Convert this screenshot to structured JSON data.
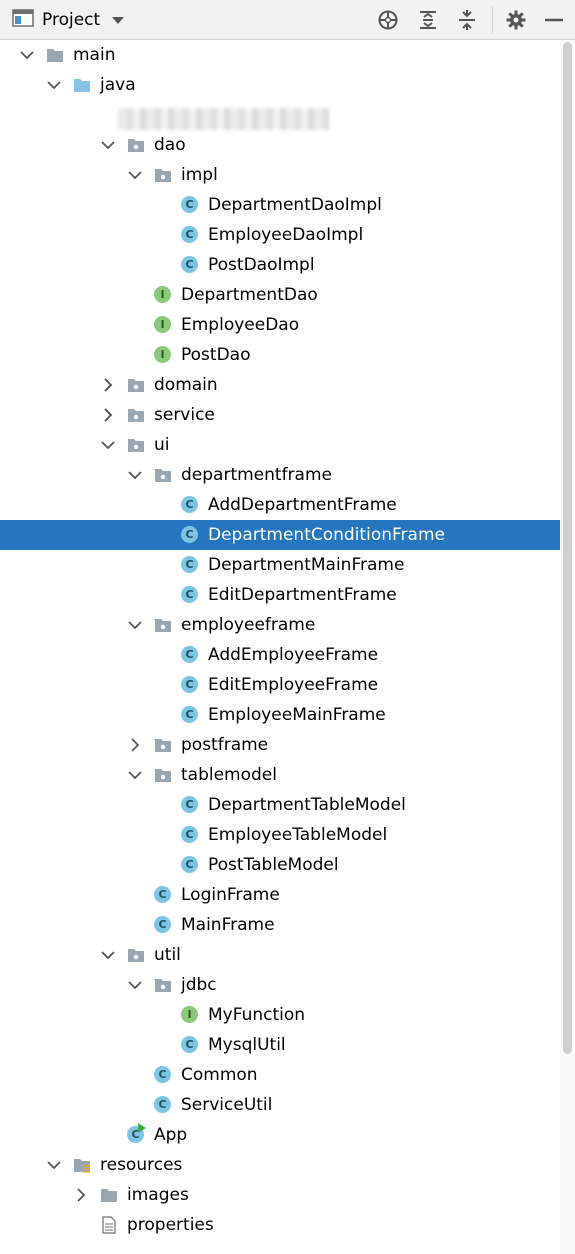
{
  "toolbar": {
    "title": "Project",
    "icons": [
      "project-window-icon",
      "dropdown-caret-icon",
      "locate-icon",
      "expand-all-icon",
      "collapse-all-icon",
      "settings-gear-icon",
      "hide-panel-icon"
    ]
  },
  "tree": {
    "rows": [
      {
        "label": "main",
        "kind": "folder",
        "expanded": true
      },
      {
        "label": "java",
        "kind": "source-folder",
        "expanded": true
      },
      {
        "label": "",
        "kind": "blurred-package"
      },
      {
        "label": "dao",
        "kind": "package",
        "expanded": true
      },
      {
        "label": "impl",
        "kind": "package",
        "expanded": true
      },
      {
        "label": "DepartmentDaoImpl",
        "kind": "class"
      },
      {
        "label": "EmployeeDaoImpl",
        "kind": "class"
      },
      {
        "label": "PostDaoImpl",
        "kind": "class"
      },
      {
        "label": "DepartmentDao",
        "kind": "interface"
      },
      {
        "label": "EmployeeDao",
        "kind": "interface"
      },
      {
        "label": "PostDao",
        "kind": "interface"
      },
      {
        "label": "domain",
        "kind": "package",
        "expanded": false
      },
      {
        "label": "service",
        "kind": "package",
        "expanded": false
      },
      {
        "label": "ui",
        "kind": "package",
        "expanded": true
      },
      {
        "label": "departmentframe",
        "kind": "package",
        "expanded": true
      },
      {
        "label": "AddDepartmentFrame",
        "kind": "class"
      },
      {
        "label": "DepartmentConditionFrame",
        "kind": "class",
        "selected": true
      },
      {
        "label": "DepartmentMainFrame",
        "kind": "class"
      },
      {
        "label": "EditDepartmentFrame",
        "kind": "class"
      },
      {
        "label": "employeeframe",
        "kind": "package",
        "expanded": true
      },
      {
        "label": "AddEmployeeFrame",
        "kind": "class"
      },
      {
        "label": "EditEmployeeFrame",
        "kind": "class"
      },
      {
        "label": "EmployeeMainFrame",
        "kind": "class"
      },
      {
        "label": "postframe",
        "kind": "package",
        "expanded": false
      },
      {
        "label": "tablemodel",
        "kind": "package",
        "expanded": true
      },
      {
        "label": "DepartmentTableModel",
        "kind": "class"
      },
      {
        "label": "EmployeeTableModel",
        "kind": "class"
      },
      {
        "label": "PostTableModel",
        "kind": "class"
      },
      {
        "label": "LoginFrame",
        "kind": "class"
      },
      {
        "label": "MainFrame",
        "kind": "class"
      },
      {
        "label": "util",
        "kind": "package",
        "expanded": true
      },
      {
        "label": "jdbc",
        "kind": "package",
        "expanded": true
      },
      {
        "label": "MyFunction",
        "kind": "interface"
      },
      {
        "label": "MysqlUtil",
        "kind": "class"
      },
      {
        "label": "Common",
        "kind": "class"
      },
      {
        "label": "ServiceUtil",
        "kind": "class"
      },
      {
        "label": "App",
        "kind": "main-class"
      },
      {
        "label": "resources",
        "kind": "resources-folder",
        "expanded": true
      },
      {
        "label": "images",
        "kind": "folder",
        "expanded": false
      },
      {
        "label": "properties",
        "kind": "file"
      }
    ]
  },
  "colors": {
    "selection": "#2675bf",
    "class_icon": "#7cc6e4",
    "interface_icon": "#8cc97a",
    "folder": "#9aa7b0",
    "source_folder": "#87c3e6"
  }
}
